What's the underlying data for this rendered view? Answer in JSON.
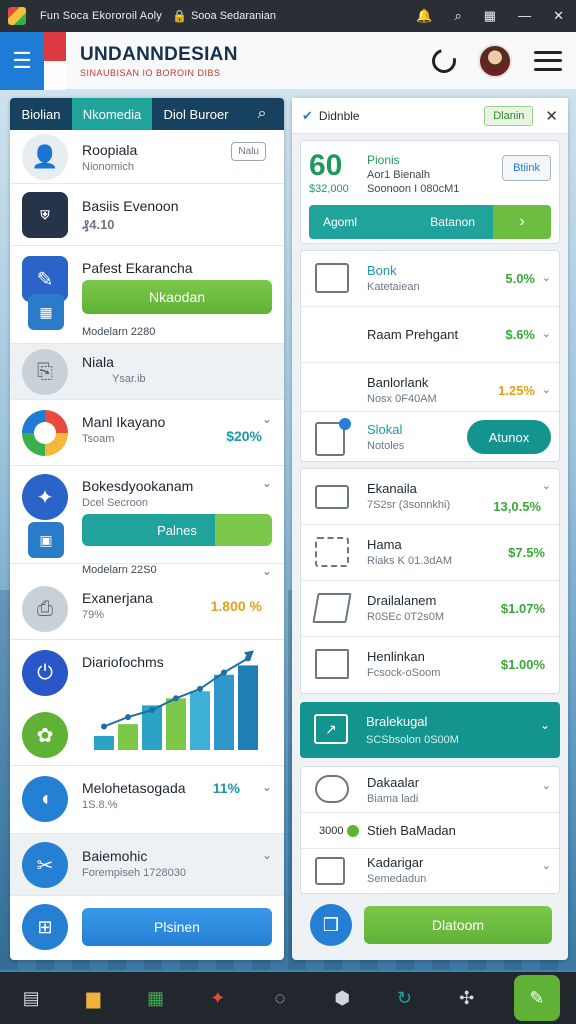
{
  "statusbar": {
    "app_title": "Fun Soca Ekororoil Aoly",
    "secure_label": "Sooa Sedaranian",
    "icons": [
      "bell-icon",
      "search-icon",
      "grid-icon",
      "minimize-icon",
      "close-icon"
    ]
  },
  "header": {
    "brand": "UNDANNDESIAN",
    "tagline": "SINAUBISAN IO BOROIN DIBS",
    "colors": {
      "accent": "#1e7bd6",
      "brand_red": "#d8262b"
    }
  },
  "left": {
    "tabs": [
      "Biolian",
      "Nkomedia",
      "Diol Buroer"
    ],
    "items": [
      {
        "title": "Roopiala",
        "sub": "Nionomich",
        "badge": "Nalu"
      },
      {
        "title": "Basiis Evenoon",
        "value": "₰4.10"
      },
      {
        "title": "Pafest Ekarancha",
        "button": "Nkaodan",
        "caption": "Modelarn 2280"
      },
      {
        "title": "Niala",
        "sub": "Ysar.ib"
      },
      {
        "title": "Manl Ikayano",
        "sub": "Tsoam",
        "value": "$20%"
      },
      {
        "title": "Bokesdyookanam",
        "sub": "Dcel Secroon",
        "button": "Palnes",
        "caption": "Modelarn 22S0"
      },
      {
        "title": "Exanerjana",
        "sub": "79%",
        "value": "1.800 %"
      },
      {
        "title": "Diariofochms"
      },
      {
        "title": "Melohetasogada",
        "sub": "1S.8.%",
        "value": "11%"
      },
      {
        "title": "Baiemohic",
        "sub": "Forempiseh 1728030"
      }
    ],
    "chart_data": {
      "type": "bar",
      "values": [
        12,
        22,
        38,
        44,
        50,
        64,
        72
      ],
      "line": [
        20,
        28,
        34,
        44,
        52,
        66,
        78
      ]
    },
    "footer_button": "Plsinen"
  },
  "right": {
    "header_title": "Didnble",
    "header_button": "Dlanin",
    "summary": {
      "big": "60",
      "sub_value": "$32,000",
      "title": "Pionis",
      "line1": "Aor1 Bienalh",
      "line2": "Soonoon I 080cM1",
      "side_button": "Btiink"
    },
    "progress": {
      "left": "Agoml",
      "mid": "Batanon"
    },
    "card1": [
      {
        "title": "Bonk",
        "sub": "Katetaiean",
        "value": "5.0%"
      },
      {
        "title": "Raam Prehgant",
        "value": "$.6%"
      },
      {
        "title": "Banlorlank",
        "sub": "Nosx 0F40AM",
        "value": "1.25%"
      }
    ],
    "action": {
      "title": "Slokal",
      "sub": "Notoles",
      "button": "Atunox"
    },
    "card2": [
      {
        "title": "Ekanaila",
        "sub": "7S2sr (3sonnkhi)",
        "value": "13,0.5%"
      },
      {
        "title": "Hama",
        "sub": "Riaks K 01.3dAM",
        "value": "$7.5%"
      },
      {
        "title": "Drailalanem",
        "sub": "R0SEc 0T2s0M",
        "value": "$1.07%"
      },
      {
        "title": "Henlinkan",
        "sub": "Fcsock-oSoom",
        "value": "$1.00%"
      }
    ],
    "banner": {
      "title": "Bralekugal",
      "sub": "SCSbsolon 0S00M"
    },
    "card3": [
      {
        "title": "Dakaalar",
        "sub": "Biama ladi"
      },
      {
        "prefix": "3000",
        "title": "Stieh BaMadan"
      },
      {
        "title": "Kadarigar",
        "sub": "Semedadun"
      }
    ],
    "footer_button": "Dlatoom"
  },
  "taskbar": [
    "storage-icon",
    "folder-icon",
    "spreadsheet-icon",
    "tools-icon",
    "compass-icon",
    "cube-icon",
    "refresh-icon",
    "link-icon",
    "edit-app-icon"
  ]
}
